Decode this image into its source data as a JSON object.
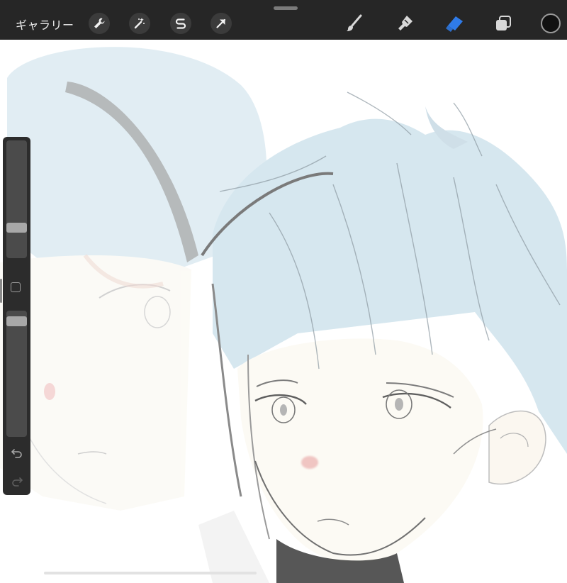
{
  "topbar": {
    "gallery_label": "ギャラリー",
    "left_tools": [
      {
        "icon": "wrench-icon",
        "name": "actions-button"
      },
      {
        "icon": "magic-wand-icon",
        "name": "adjustments-button"
      },
      {
        "icon": "selection-icon",
        "name": "selection-button"
      },
      {
        "icon": "transform-arrow-icon",
        "name": "transform-button"
      }
    ],
    "right_tools": [
      {
        "icon": "brush-icon",
        "name": "paint-button"
      },
      {
        "icon": "smudge-icon",
        "name": "smudge-button"
      },
      {
        "icon": "eraser-icon",
        "name": "eraser-button",
        "active": true
      },
      {
        "icon": "layers-icon",
        "name": "layers-button"
      }
    ],
    "current_color": "#111111"
  },
  "sidebar": {
    "brush_size_level": 0.24,
    "opacity_level": 0.95
  },
  "colors": {
    "toolbar_bg": "#262626",
    "active_tool": "#2f7be8",
    "hair_blue": "#d7e8f0",
    "skin": "#fcfaf4",
    "cheek_pink": "#f2c9c9"
  }
}
